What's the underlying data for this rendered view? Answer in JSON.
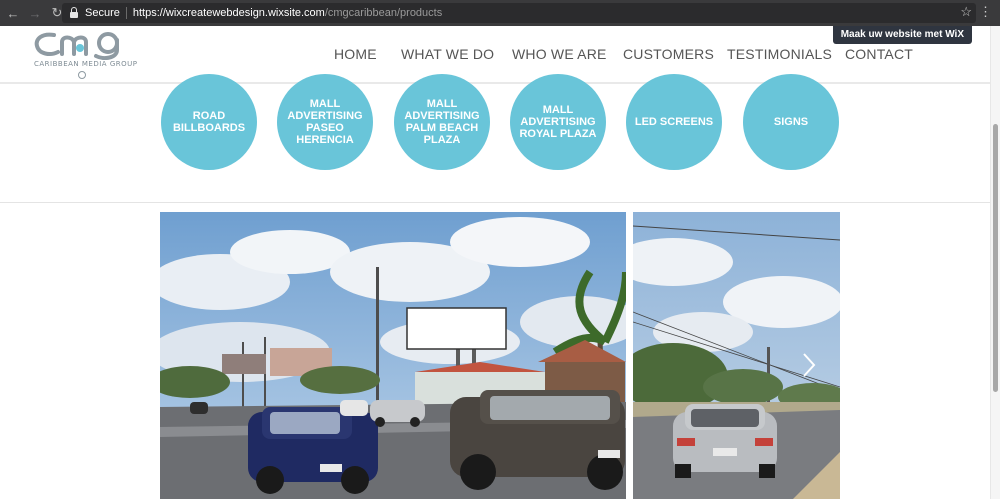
{
  "browser": {
    "secure_label": "Secure",
    "url_host": "https://wixcreatewebdesign.wixsite.com",
    "url_path": "/cmgcaribbean/products"
  },
  "logo": {
    "subtitle": "CARIBBEAN MEDIA GROUP",
    "brand_color": "#8e9aa2"
  },
  "nav": {
    "items": [
      {
        "label": "HOME"
      },
      {
        "label": "WHAT WE DO"
      },
      {
        "label": "WHO WE ARE"
      },
      {
        "label": "CUSTOMERS"
      },
      {
        "label": "TESTIMONIALS"
      },
      {
        "label": "CONTACT"
      }
    ]
  },
  "wix_banner": {
    "label": "Maak uw website met WiX"
  },
  "products": {
    "accent_color": "#69c5d9",
    "items": [
      {
        "label": "ROAD BILLBOARDS"
      },
      {
        "label": "MALL ADVERTISING PASEO HERENCIA"
      },
      {
        "label": "MALL ADVERTISING PALM BEACH PLAZA"
      },
      {
        "label": "MALL ADVERTISING ROYAL PLAZA"
      },
      {
        "label": "LED SCREENS"
      },
      {
        "label": "SIGNS"
      }
    ]
  },
  "gallery": {
    "photos": [
      {
        "icon": "billboard-road-photo"
      },
      {
        "icon": "road-car-photo"
      }
    ],
    "next_icon": "chevron-right-icon"
  }
}
